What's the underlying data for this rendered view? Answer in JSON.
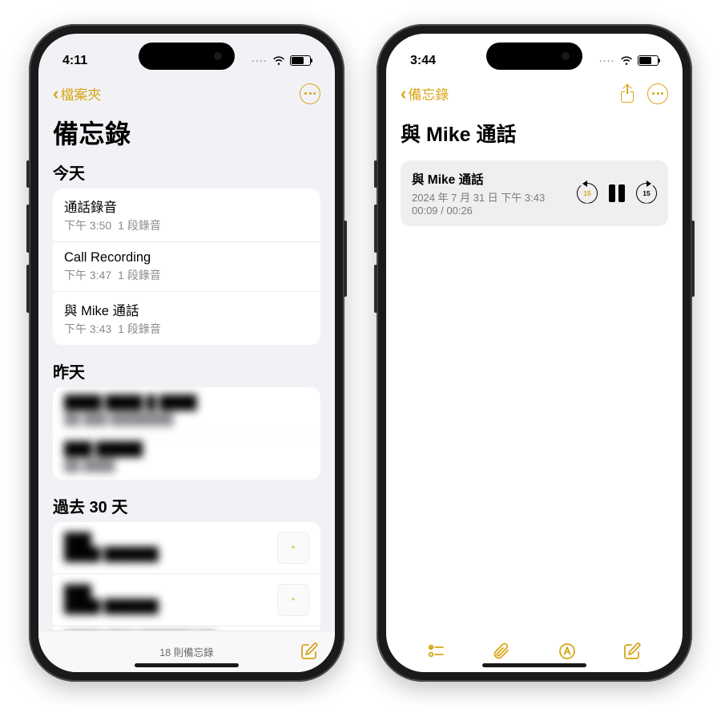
{
  "accent": "#d7a618",
  "left": {
    "status_time": "4:11",
    "back_label": "檔案夾",
    "page_title": "備忘錄",
    "section_today": "今天",
    "section_yesterday": "昨天",
    "section_past30": "過去 30 天",
    "today_items": [
      {
        "title": "通話錄音",
        "time": "下午 3:50",
        "meta": "1 段錄音"
      },
      {
        "title": "Call Recording",
        "time": "下午 3:47",
        "meta": "1 段錄音"
      },
      {
        "title": "與 Mike 通話",
        "time": "下午 3:43",
        "meta": "1 段錄音"
      }
    ],
    "note_count": "18 則備忘錄"
  },
  "right": {
    "status_time": "3:44",
    "back_label": "備忘錄",
    "note_title": "與 Mike 通話",
    "audio": {
      "title": "與 Mike 通話",
      "date": "2024 年 7 月 31 日 下午 3:43",
      "progress": "00:09 / 00:26",
      "skip_secs": "15"
    }
  }
}
